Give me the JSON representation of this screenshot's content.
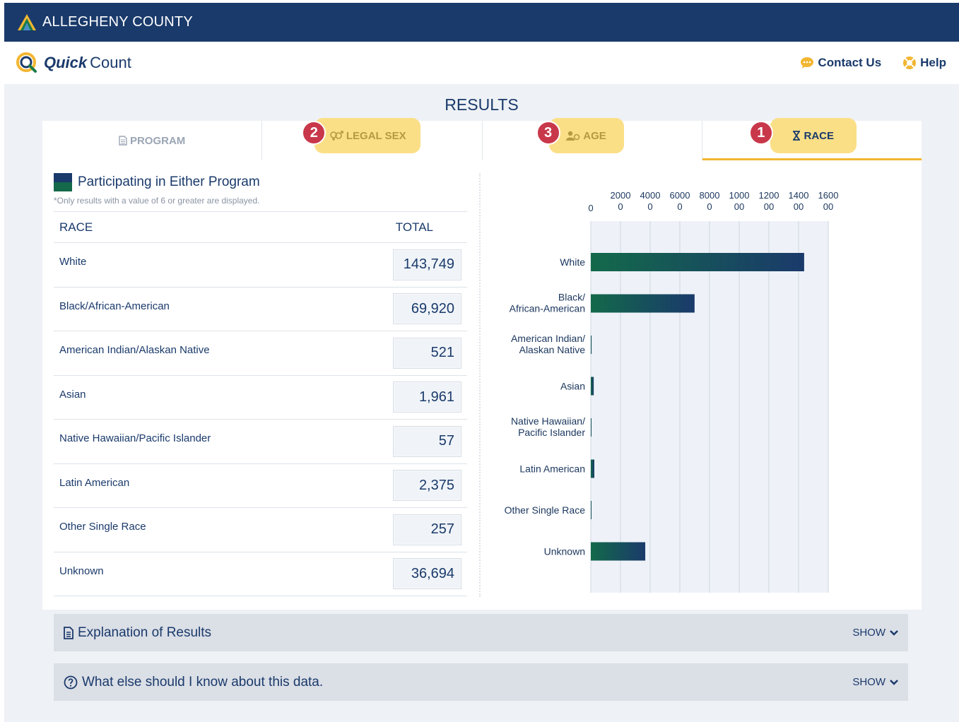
{
  "header": {
    "county": "ALLEGHENY COUNTY"
  },
  "app": {
    "brand_quick": "Quick",
    "brand_count": "Count"
  },
  "nav": {
    "contact": "Contact Us",
    "help": "Help"
  },
  "main": {
    "title": "RESULTS"
  },
  "tabs": [
    {
      "label": "PROGRAM",
      "badge": "",
      "icon": "document-icon"
    },
    {
      "label": "LEGAL SEX",
      "badge": "2",
      "icon": "gender-icon"
    },
    {
      "label": "AGE",
      "badge": "3",
      "icon": "people-icon"
    },
    {
      "label": "RACE",
      "badge": "1",
      "icon": "hourglass-icon"
    }
  ],
  "table": {
    "legend_title": "Participating in Either Program",
    "note": "*Only results with a value of 6 or greater are displayed.",
    "col_race": "RACE",
    "col_total": "TOTAL",
    "rows": [
      {
        "race": "White",
        "total": "143,749"
      },
      {
        "race": "Black/African-American",
        "total": "69,920"
      },
      {
        "race": "American Indian/Alaskan Native",
        "total": "521"
      },
      {
        "race": "Asian",
        "total": "1,961"
      },
      {
        "race": "Native Hawaiian/Pacific Islander",
        "total": "57"
      },
      {
        "race": "Latin American",
        "total": "2,375"
      },
      {
        "race": "Other Single Race",
        "total": "257"
      },
      {
        "race": "Unknown",
        "total": "36,694"
      }
    ]
  },
  "chart_data": {
    "type": "bar",
    "orientation": "horizontal",
    "categories": [
      [
        "White"
      ],
      [
        "Black/",
        "African-American"
      ],
      [
        "American Indian/",
        "Alaskan Native"
      ],
      [
        "Asian"
      ],
      [
        "Native Hawaiian/",
        "Pacific Islander"
      ],
      [
        "Latin American"
      ],
      [
        "Other Single Race"
      ],
      [
        "Unknown"
      ]
    ],
    "values": [
      143749,
      69920,
      521,
      1961,
      57,
      2375,
      257,
      36694
    ],
    "xlim": [
      0,
      160000
    ],
    "ticks": [
      [
        "0"
      ],
      [
        "2000",
        "0"
      ],
      [
        "4000",
        "0"
      ],
      [
        "6000",
        "0"
      ],
      [
        "8000",
        "0"
      ],
      [
        "1000",
        "00"
      ],
      [
        "1200",
        "00"
      ],
      [
        "1400",
        "00"
      ],
      [
        "1600",
        "00"
      ]
    ],
    "grid": true,
    "axis_position": "top",
    "colors": {
      "bar_start": "#13694a",
      "bar_end": "#1a3a6b",
      "plot_bg": "#eef2f8"
    }
  },
  "accordions": [
    {
      "title": "Explanation of Results",
      "action": "SHOW"
    },
    {
      "title": "What else should I know about this data.",
      "action": "SHOW"
    }
  ]
}
